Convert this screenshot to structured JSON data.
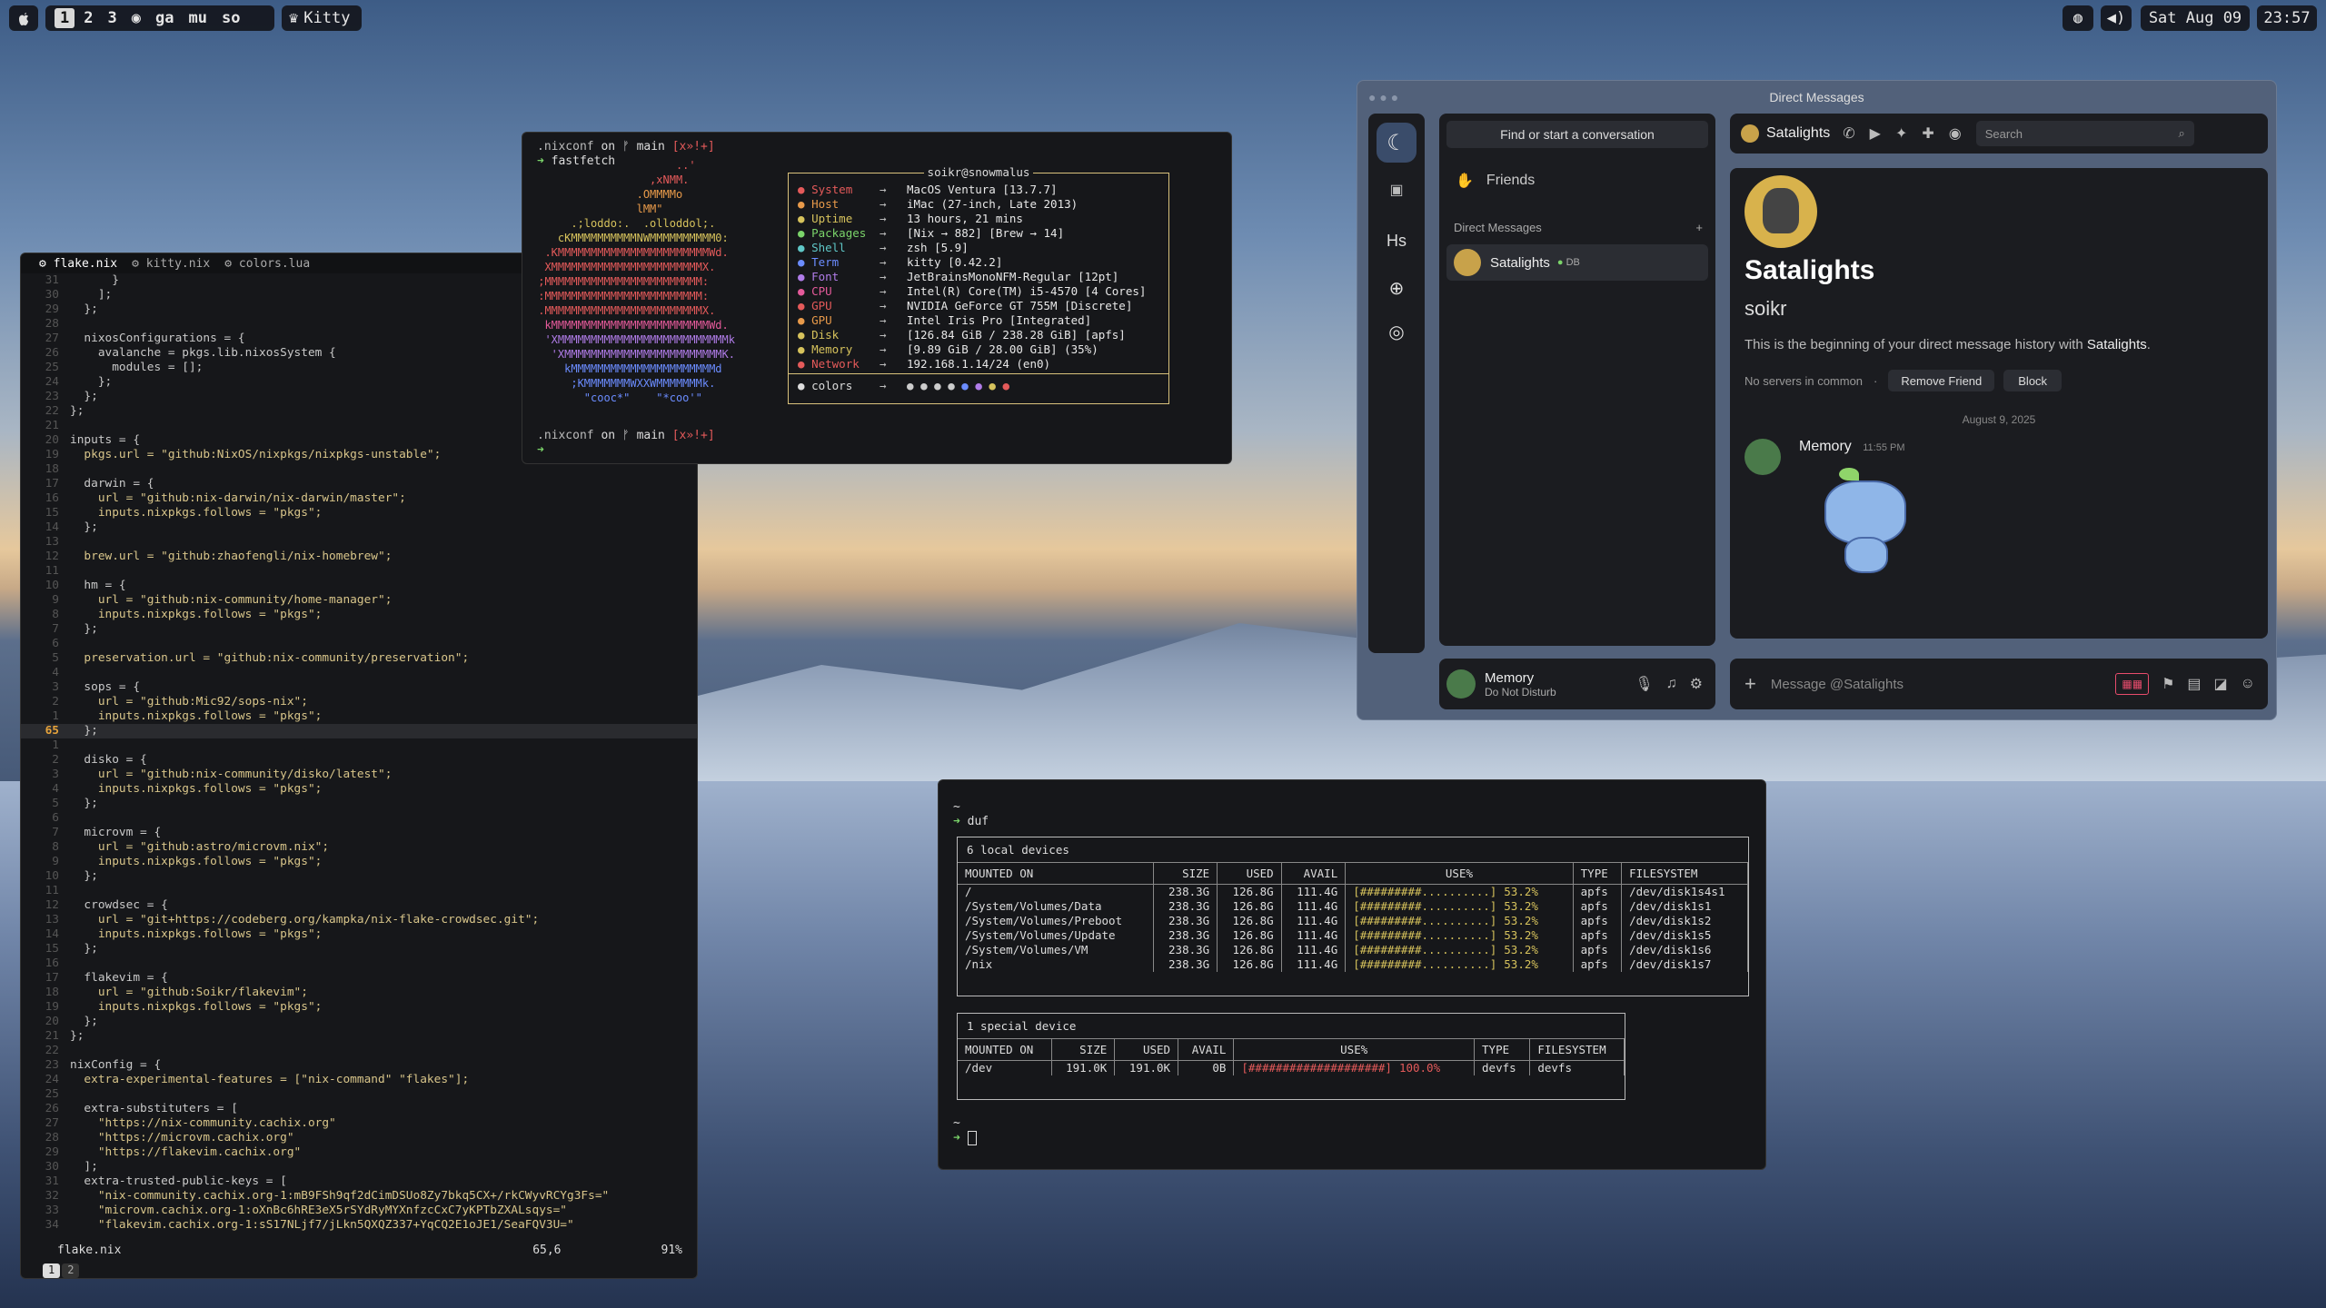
{
  "topbar": {
    "workspaces": [
      "1",
      "2",
      "3",
      "ga",
      "mu",
      "so"
    ],
    "active_workspace": "1",
    "app": "Kitty",
    "date": "Sat Aug 09",
    "time": "23:57"
  },
  "editor": {
    "tabs": [
      "flake.nix",
      "kitty.nix",
      "colors.lua"
    ],
    "status_file": "flake.nix",
    "status_pos": "65,6",
    "status_pct": "91%",
    "buffers": [
      "1",
      "2"
    ],
    "lines": [
      {
        "n": "31",
        "t": "      }"
      },
      {
        "n": "30",
        "t": "    ];"
      },
      {
        "n": "29",
        "t": "  };"
      },
      {
        "n": "28",
        "t": ""
      },
      {
        "n": "27",
        "t": "  nixosConfigurations = {"
      },
      {
        "n": "26",
        "t": "    avalanche = pkgs.lib.nixosSystem {"
      },
      {
        "n": "25",
        "t": "      modules = [];"
      },
      {
        "n": "24",
        "t": "    };"
      },
      {
        "n": "23",
        "t": "  };"
      },
      {
        "n": "22",
        "t": "};"
      },
      {
        "n": "21",
        "t": ""
      },
      {
        "n": "20",
        "t": "inputs = {"
      },
      {
        "n": "19",
        "t": "  pkgs.url = \"github:NixOS/nixpkgs/nixpkgs-unstable\";"
      },
      {
        "n": "18",
        "t": ""
      },
      {
        "n": "17",
        "t": "  darwin = {"
      },
      {
        "n": "16",
        "t": "    url = \"github:nix-darwin/nix-darwin/master\";"
      },
      {
        "n": "15",
        "t": "    inputs.nixpkgs.follows = \"pkgs\";"
      },
      {
        "n": "14",
        "t": "  };"
      },
      {
        "n": "13",
        "t": ""
      },
      {
        "n": "12",
        "t": "  brew.url = \"github:zhaofengli/nix-homebrew\";"
      },
      {
        "n": "11",
        "t": ""
      },
      {
        "n": "10",
        "t": "  hm = {"
      },
      {
        "n": "9",
        "t": "    url = \"github:nix-community/home-manager\";"
      },
      {
        "n": "8",
        "t": "    inputs.nixpkgs.follows = \"pkgs\";"
      },
      {
        "n": "7",
        "t": "  };"
      },
      {
        "n": "6",
        "t": ""
      },
      {
        "n": "5",
        "t": "  preservation.url = \"github:nix-community/preservation\";"
      },
      {
        "n": "4",
        "t": ""
      },
      {
        "n": "3",
        "t": "  sops = {"
      },
      {
        "n": "2",
        "t": "    url = \"github:Mic92/sops-nix\";"
      },
      {
        "n": "1",
        "t": "    inputs.nixpkgs.follows = \"pkgs\";"
      },
      {
        "n": "65",
        "t": "  };",
        "cur": true
      },
      {
        "n": "1",
        "t": ""
      },
      {
        "n": "2",
        "t": "  disko = {"
      },
      {
        "n": "3",
        "t": "    url = \"github:nix-community/disko/latest\";"
      },
      {
        "n": "4",
        "t": "    inputs.nixpkgs.follows = \"pkgs\";"
      },
      {
        "n": "5",
        "t": "  };"
      },
      {
        "n": "6",
        "t": ""
      },
      {
        "n": "7",
        "t": "  microvm = {"
      },
      {
        "n": "8",
        "t": "    url = \"github:astro/microvm.nix\";"
      },
      {
        "n": "9",
        "t": "    inputs.nixpkgs.follows = \"pkgs\";"
      },
      {
        "n": "10",
        "t": "  };"
      },
      {
        "n": "11",
        "t": ""
      },
      {
        "n": "12",
        "t": "  crowdsec = {"
      },
      {
        "n": "13",
        "t": "    url = \"git+https://codeberg.org/kampka/nix-flake-crowdsec.git\";"
      },
      {
        "n": "14",
        "t": "    inputs.nixpkgs.follows = \"pkgs\";"
      },
      {
        "n": "15",
        "t": "  };"
      },
      {
        "n": "16",
        "t": ""
      },
      {
        "n": "17",
        "t": "  flakevim = {"
      },
      {
        "n": "18",
        "t": "    url = \"github:Soikr/flakevim\";"
      },
      {
        "n": "19",
        "t": "    inputs.nixpkgs.follows = \"pkgs\";"
      },
      {
        "n": "20",
        "t": "  };"
      },
      {
        "n": "21",
        "t": "};"
      },
      {
        "n": "22",
        "t": ""
      },
      {
        "n": "23",
        "t": "nixConfig = {"
      },
      {
        "n": "24",
        "t": "  extra-experimental-features = [\"nix-command\" \"flakes\"];"
      },
      {
        "n": "25",
        "t": ""
      },
      {
        "n": "26",
        "t": "  extra-substituters = ["
      },
      {
        "n": "27",
        "t": "    \"https://nix-community.cachix.org\""
      },
      {
        "n": "28",
        "t": "    \"https://microvm.cachix.org\""
      },
      {
        "n": "29",
        "t": "    \"https://flakevim.cachix.org\""
      },
      {
        "n": "30",
        "t": "  ];"
      },
      {
        "n": "31",
        "t": "  extra-trusted-public-keys = ["
      },
      {
        "n": "32",
        "t": "    \"nix-community.cachix.org-1:mB9FSh9qf2dCimDSUo8Zy7bkq5CX+/rkCWyvRCYg3Fs=\""
      },
      {
        "n": "33",
        "t": "    \"microvm.cachix.org-1:oXnBc6hRE3eX5rSYdRyMYXnfzcCxC7yKPTbZXALsqys=\""
      },
      {
        "n": "34",
        "t": "    \"flakevim.cachix.org-1:sS17NLjf7/jLkn5QXQZ337+YqCQ2E1oJE1/SeaFQV3U=\""
      }
    ]
  },
  "fastfetch": {
    "prompt1_dir": ".nixconf",
    "prompt1_on": "on",
    "prompt1_branch": "main",
    "prompt1_status": "[x»!+]",
    "command": "fastfetch",
    "header": "soikr@snowmalus",
    "logo": [
      "                      ..'",
      "                  ,xNMM.",
      "                .OMMMMo",
      "                lMM\"",
      "      .;loddo:.  .olloddol;.",
      "    cKMMMMMMMMMMNWMMMMMMMMMM0:",
      "  .KMMMMMMMMMMMMMMMMMMMMMMMWd.",
      "  XMMMMMMMMMMMMMMMMMMMMMMMX.",
      " ;MMMMMMMMMMMMMMMMMMMMMMMM:",
      " :MMMMMMMMMMMMMMMMMMMMMMMM:",
      " .MMMMMMMMMMMMMMMMMMMMMMMMX.",
      "  kMMMMMMMMMMMMMMMMMMMMMMMMWd.",
      "  'XMMMMMMMMMMMMMMMMMMMMMMMMMMk",
      "   'XMMMMMMMMMMMMMMMMMMMMMMMMK.",
      "     kMMMMMMMMMMMMMMMMMMMMMMd",
      "      ;KMMMMMMMWXXWMMMMMMMk.",
      "        \"cooc*\"    \"*coo'\""
    ],
    "rows": [
      {
        "k": "System",
        "v": "MacOS Ventura [13.7.7]",
        "c": "#e45a5a"
      },
      {
        "k": "Host",
        "v": "iMac (27-inch, Late 2013)",
        "c": "#e89a4a"
      },
      {
        "k": "Uptime",
        "v": "13 hours, 21 mins",
        "c": "#d6c25c"
      },
      {
        "k": "Packages",
        "v": "[Nix → 882] [Brew → 14]",
        "c": "#7bd46a"
      },
      {
        "k": "Shell",
        "v": "zsh [5.9]",
        "c": "#5fc7c7"
      },
      {
        "k": "Term",
        "v": "kitty [0.42.2]",
        "c": "#6b8cff"
      },
      {
        "k": "Font",
        "v": "JetBrainsMonoNFM-Regular [12pt]",
        "c": "#b07ce8"
      },
      {
        "k": "CPU",
        "v": "Intel(R) Core(TM) i5-4570 [4 Cores]",
        "c": "#e45a9a"
      },
      {
        "k": "GPU",
        "v": "NVIDIA GeForce GT 755M [Discrete]",
        "c": "#e45a5a"
      },
      {
        "k": "GPU",
        "v": "Intel Iris Pro [Integrated]",
        "c": "#e89a4a"
      },
      {
        "k": "Disk",
        "v": "[126.84 GiB / 238.28 GiB] [apfs]",
        "c": "#d6c25c"
      },
      {
        "k": "Memory",
        "v": "[9.89 GiB / 28.00 GiB] (35%)",
        "c": "#d6c25c"
      },
      {
        "k": "Network",
        "v": "192.168.1.14/24 (en0)",
        "c": "#e45a5a"
      }
    ],
    "colors_label": "colors",
    "color_dots": [
      "#cccccc",
      "#cccccc",
      "#cccccc",
      "#cccccc",
      "#6b8cff",
      "#b07ce8",
      "#d6c25c",
      "#e45a5a"
    ],
    "arrow": "→",
    "prompt2_dir": ".nixconf",
    "prompt2_on": "on",
    "prompt2_branch": "main",
    "prompt2_status": "[x»!+]"
  },
  "duf": {
    "cmd": "duf",
    "local_title": "6 local devices",
    "local_headers": [
      "MOUNTED ON",
      "SIZE",
      "USED",
      "AVAIL",
      "USE%",
      "TYPE",
      "FILESYSTEM"
    ],
    "local_rows": [
      [
        "/",
        "238.3G",
        "126.8G",
        "111.4G",
        "[#########..........]",
        "53.2%",
        "apfs",
        "/dev/disk1s4s1"
      ],
      [
        "/System/Volumes/Data",
        "238.3G",
        "126.8G",
        "111.4G",
        "[#########..........]",
        "53.2%",
        "apfs",
        "/dev/disk1s1"
      ],
      [
        "/System/Volumes/Preboot",
        "238.3G",
        "126.8G",
        "111.4G",
        "[#########..........]",
        "53.2%",
        "apfs",
        "/dev/disk1s2"
      ],
      [
        "/System/Volumes/Update",
        "238.3G",
        "126.8G",
        "111.4G",
        "[#########..........]",
        "53.2%",
        "apfs",
        "/dev/disk1s5"
      ],
      [
        "/System/Volumes/VM",
        "238.3G",
        "126.8G",
        "111.4G",
        "[#########..........]",
        "53.2%",
        "apfs",
        "/dev/disk1s6"
      ],
      [
        "/nix",
        "238.3G",
        "126.8G",
        "111.4G",
        "[#########..........]",
        "53.2%",
        "apfs",
        "/dev/disk1s7"
      ]
    ],
    "special_title": "1 special device",
    "special_headers": [
      "MOUNTED ON",
      "SIZE",
      "USED",
      "AVAIL",
      "USE%",
      "TYPE",
      "FILESYSTEM"
    ],
    "special_rows": [
      [
        "/dev",
        "191.0K",
        "191.0K",
        "0B",
        "[####################]",
        "100.0%",
        "devfs",
        "devfs"
      ]
    ]
  },
  "discord": {
    "title": "Direct Messages",
    "find_placeholder": "Find or start a conversation",
    "friends": "Friends",
    "dm_header": "Direct Messages",
    "dm_item": "Satalights",
    "dm_item_badge": "DB",
    "server_label": "Hs",
    "user_name": "Memory",
    "user_status": "Do Not Disturb",
    "channel_name": "Satalights",
    "search_placeholder": "Search",
    "profile_name": "Satalights",
    "profile_username": "soikr",
    "beginning_text": "This is the beginning of your direct message history with ",
    "beginning_name": "Satalights",
    "beginning_end": ".",
    "no_servers": "No servers in common",
    "remove_friend": "Remove Friend",
    "block": "Block",
    "date_divider": "August 9, 2025",
    "msg_author": "Memory",
    "msg_time": "11:55 PM",
    "msg_placeholder": "Message @Satalights"
  }
}
